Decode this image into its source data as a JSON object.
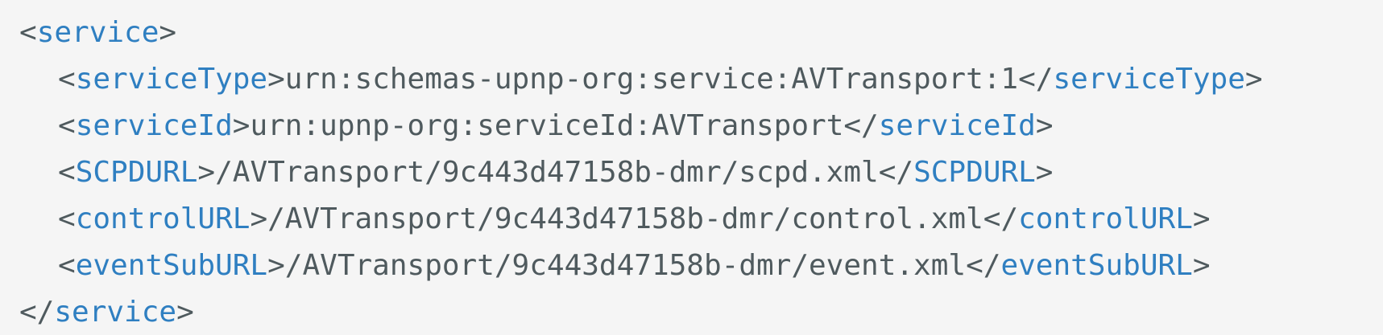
{
  "code": {
    "open_service": "service",
    "close_service": "service",
    "lines": [
      {
        "tag": "serviceType",
        "value": "urn:schemas-upnp-org:service:AVTransport:1"
      },
      {
        "tag": "serviceId",
        "value": "urn:upnp-org:serviceId:AVTransport"
      },
      {
        "tag": "SCPDURL",
        "value": "/AVTransport/9c443d47158b-dmr/scpd.xml"
      },
      {
        "tag": "controlURL",
        "value": "/AVTransport/9c443d47158b-dmr/control.xml"
      },
      {
        "tag": "eventSubURL",
        "value": "/AVTransport/9c443d47158b-dmr/event.xml"
      }
    ]
  },
  "colors": {
    "tag": "#2f7fc1",
    "text": "#4f5a5e",
    "background": "#f5f5f5"
  }
}
